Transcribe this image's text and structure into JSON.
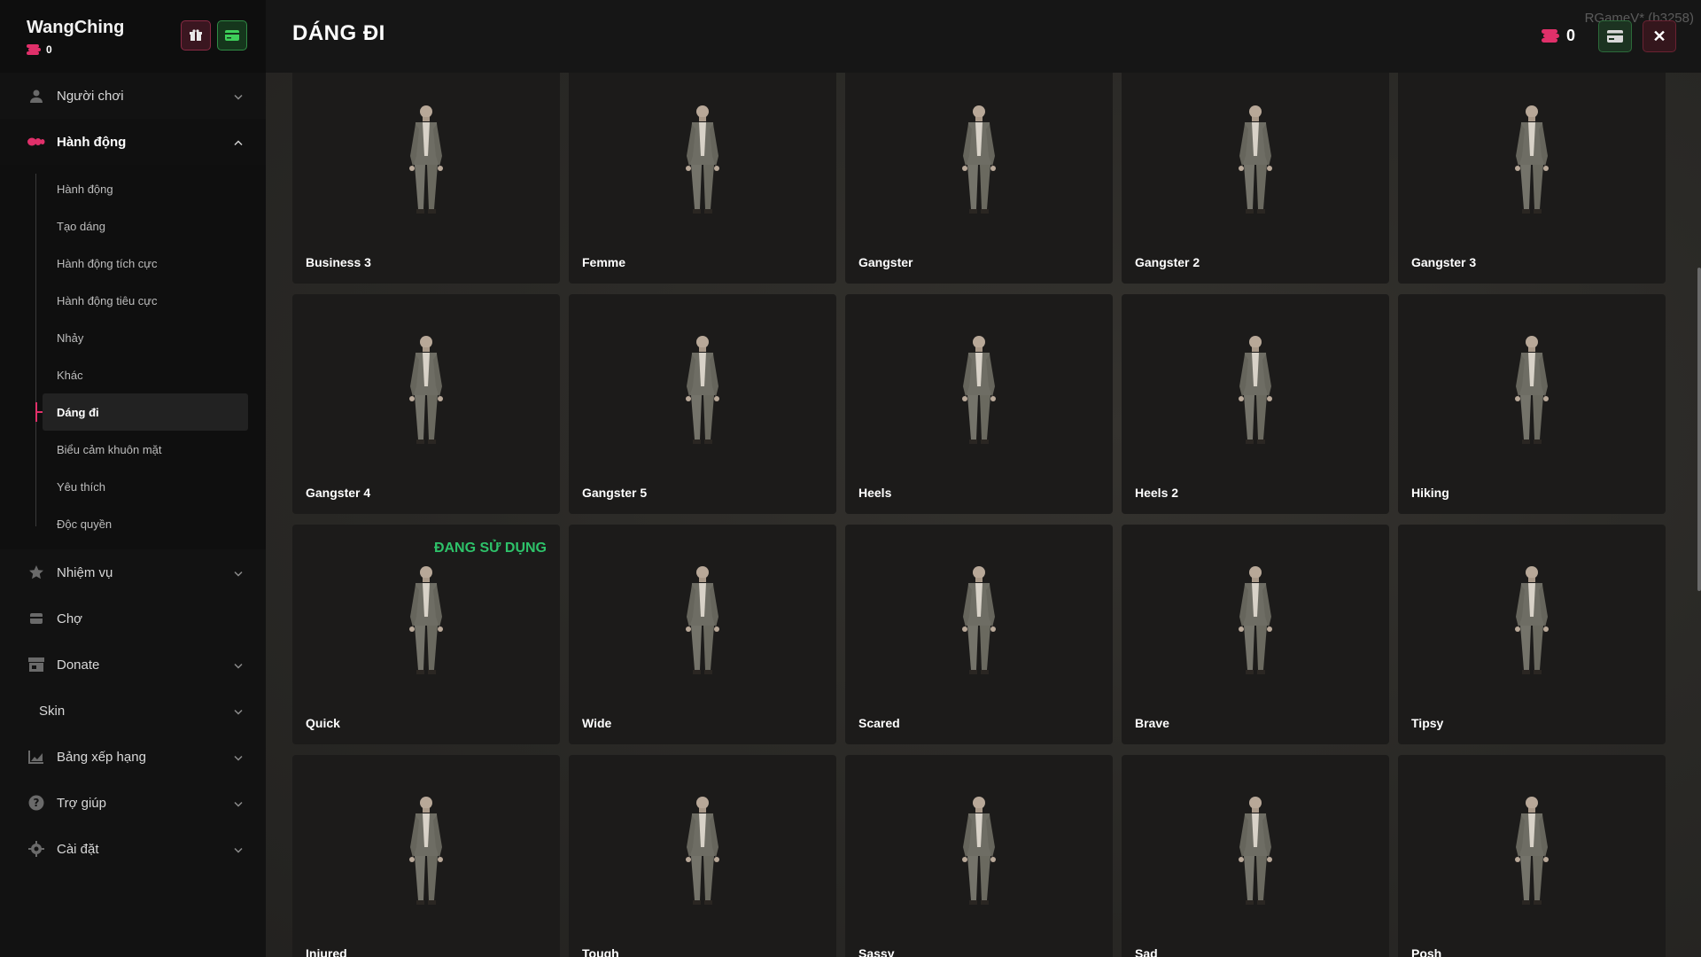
{
  "user": {
    "name": "WangChing",
    "coins": "0"
  },
  "header": {
    "title": "DÁNG ĐI",
    "coins": "0",
    "build": "RGameV* (b3258)",
    "close_label": "✕"
  },
  "sidebar": {
    "items": [
      {
        "key": "nguoi-choi",
        "label": "Người chơi",
        "icon": "user-icon",
        "chevron": "down"
      },
      {
        "key": "hanh-dong",
        "label": "Hành động",
        "icon": "pills-icon",
        "chevron": "up",
        "active": true
      },
      {
        "key": "nhiem-vu",
        "label": "Nhiệm vụ",
        "icon": "star-icon",
        "chevron": "down"
      },
      {
        "key": "cho",
        "label": "Chợ",
        "icon": "shop-icon",
        "chevron": ""
      },
      {
        "key": "donate",
        "label": "Donate",
        "icon": "store-icon",
        "chevron": "down"
      },
      {
        "key": "skin",
        "label": "Skin",
        "icon": "",
        "chevron": "down"
      },
      {
        "key": "bang-xep-hang",
        "label": "Bảng xếp hạng",
        "icon": "chart-icon",
        "chevron": "down"
      },
      {
        "key": "tro-giup",
        "label": "Trợ giúp",
        "icon": "help-icon",
        "chevron": "down"
      },
      {
        "key": "cai-dat",
        "label": "Cài đặt",
        "icon": "gear-icon",
        "chevron": "down"
      }
    ],
    "submenu": [
      {
        "label": "Hành động"
      },
      {
        "label": "Tạo dáng"
      },
      {
        "label": "Hành động tích cực"
      },
      {
        "label": "Hành động tiêu cực"
      },
      {
        "label": "Nhảy"
      },
      {
        "label": "Khác"
      },
      {
        "label": "Dáng đi",
        "active": true
      },
      {
        "label": "Biểu cảm khuôn mặt"
      },
      {
        "label": "Yêu thích"
      },
      {
        "label": "Độc quyền"
      }
    ]
  },
  "walk_styles": {
    "in_use_label": "ĐANG SỬ DỤNG",
    "items": [
      {
        "label": "Business 3"
      },
      {
        "label": "Femme"
      },
      {
        "label": "Gangster"
      },
      {
        "label": "Gangster 2"
      },
      {
        "label": "Gangster 3"
      },
      {
        "label": "Gangster 4"
      },
      {
        "label": "Gangster 5"
      },
      {
        "label": "Heels"
      },
      {
        "label": "Heels 2"
      },
      {
        "label": "Hiking"
      },
      {
        "label": "Quick",
        "in_use": true
      },
      {
        "label": "Wide"
      },
      {
        "label": "Scared"
      },
      {
        "label": "Brave"
      },
      {
        "label": "Tipsy"
      },
      {
        "label": "Injured"
      },
      {
        "label": "Tough"
      },
      {
        "label": "Sassy"
      },
      {
        "label": "Sad"
      },
      {
        "label": "Posh"
      }
    ]
  },
  "colors": {
    "accent": "#e0306a",
    "in_use": "#2ec26a",
    "wallet": "#2f8a44"
  }
}
